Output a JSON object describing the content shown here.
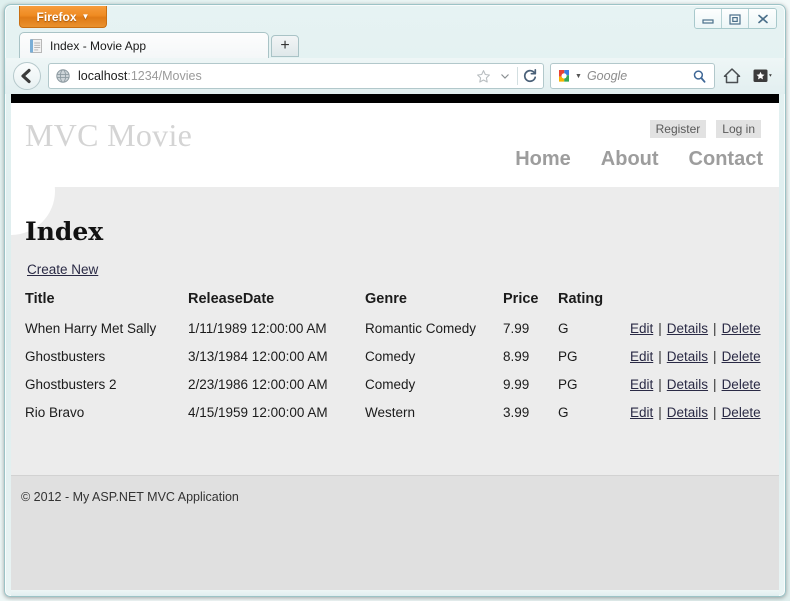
{
  "browser": {
    "app_button": {
      "label": "Firefox",
      "caret_icon": "chevron-down-icon"
    },
    "window_controls": {
      "minimize": "minimize-icon",
      "restore": "restore-icon",
      "close": "close-icon"
    },
    "tab": {
      "title": "Index - Movie App",
      "favicon": "document-favicon-icon"
    },
    "new_tab_label": "+",
    "toolbar": {
      "back_icon": "back-arrow-icon",
      "site_identity_icon": "globe-icon",
      "url_host": "localhost",
      "url_path": ":1234/Movies",
      "bookmark_star_icon": "star-icon",
      "dropdown_caret_icon": "chevron-down-icon",
      "reload_icon": "reload-icon",
      "home_icon": "home-icon",
      "bookmarks_icon": "bookmarks-star-icon",
      "bookmarks_caret_icon": "chevron-down-icon"
    },
    "search": {
      "engine_icon": "google-icon",
      "engine_caret_icon": "chevron-down-icon",
      "placeholder": "Google",
      "magnifier_icon": "search-icon"
    }
  },
  "page": {
    "logo": "MVC Movie",
    "account_links": [
      {
        "label": "Register"
      },
      {
        "label": "Log in"
      }
    ],
    "nav_links": [
      {
        "label": "Home"
      },
      {
        "label": "About"
      },
      {
        "label": "Contact"
      }
    ],
    "title": "Index",
    "create_new_label": "Create New",
    "table": {
      "headers": [
        "Title",
        "ReleaseDate",
        "Genre",
        "Price",
        "Rating"
      ],
      "rows": [
        {
          "title": "When Harry Met Sally",
          "release_date": "1/11/1989 12:00:00 AM",
          "genre": "Romantic Comedy",
          "price": "7.99",
          "rating": "G"
        },
        {
          "title": "Ghostbusters",
          "release_date": "3/13/1984 12:00:00 AM",
          "genre": "Comedy",
          "price": "8.99",
          "rating": "PG"
        },
        {
          "title": "Ghostbusters 2",
          "release_date": "2/23/1986 12:00:00 AM",
          "genre": "Comedy",
          "price": "9.99",
          "rating": "PG"
        },
        {
          "title": "Rio Bravo",
          "release_date": "4/15/1959 12:00:00 AM",
          "genre": "Western",
          "price": "3.99",
          "rating": "G"
        }
      ],
      "actions": [
        "Edit",
        "Details",
        "Delete"
      ],
      "action_separator": "|"
    },
    "footer": "© 2012 - My ASP.NET MVC Application"
  },
  "colors": {
    "firefox_orange": "#ef8b22",
    "site_strip": "#000000",
    "body_bg": "#ececec",
    "footer_bg": "#e0e0e0",
    "link": "#2a2a45",
    "logo": "#d4d4d4",
    "nav": "#9d9d9d"
  }
}
